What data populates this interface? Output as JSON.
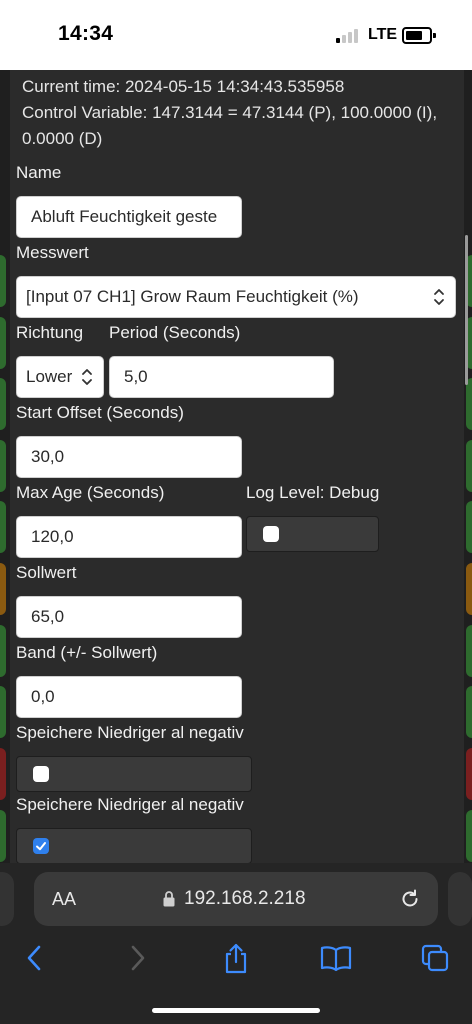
{
  "status_bar": {
    "time": "14:34",
    "network": "LTE"
  },
  "info": {
    "current_time": "Current time: 2024-05-15 14:34:43.535958",
    "control_variable": "Control Variable: 147.3144 = 47.3144 (P), 100.0000 (I), 0.0000 (D)"
  },
  "form": {
    "name_label": "Name",
    "name_value": "Abluft Feuchtigkeit geste",
    "messwert_label": "Messwert",
    "messwert_value": "[Input 07 CH1] Grow Raum Feuchtigkeit (%)",
    "richtung_label": "Richtung",
    "richtung_value": "Lower",
    "period_label": "Period (Seconds)",
    "period_value": "5,0",
    "start_offset_label": "Start Offset (Seconds)",
    "start_offset_value": "30,0",
    "max_age_label": "Max Age (Seconds)",
    "max_age_value": "120,0",
    "log_level_label": "Log Level: Debug",
    "log_level_checked": false,
    "sollwert_label": "Sollwert",
    "sollwert_value": "65,0",
    "band_label": "Band (+/- Sollwert)",
    "band_value": "0,0",
    "store_lower_label_1": "Speichere Niedriger al negativ",
    "store_lower_checked_1": false,
    "store_lower_label_2": "Speichere Niedriger al negativ",
    "store_lower_checked_2": true
  },
  "browser": {
    "text_size_label": "AA",
    "url": "192.168.2.218"
  },
  "colors": {
    "checkbox_checked": "#2f80ed",
    "panel_bg": "#2b2b2b",
    "edge_green": "#2e6b2e",
    "edge_red": "#7a1f1f",
    "edge_orange": "#8a5a10"
  }
}
